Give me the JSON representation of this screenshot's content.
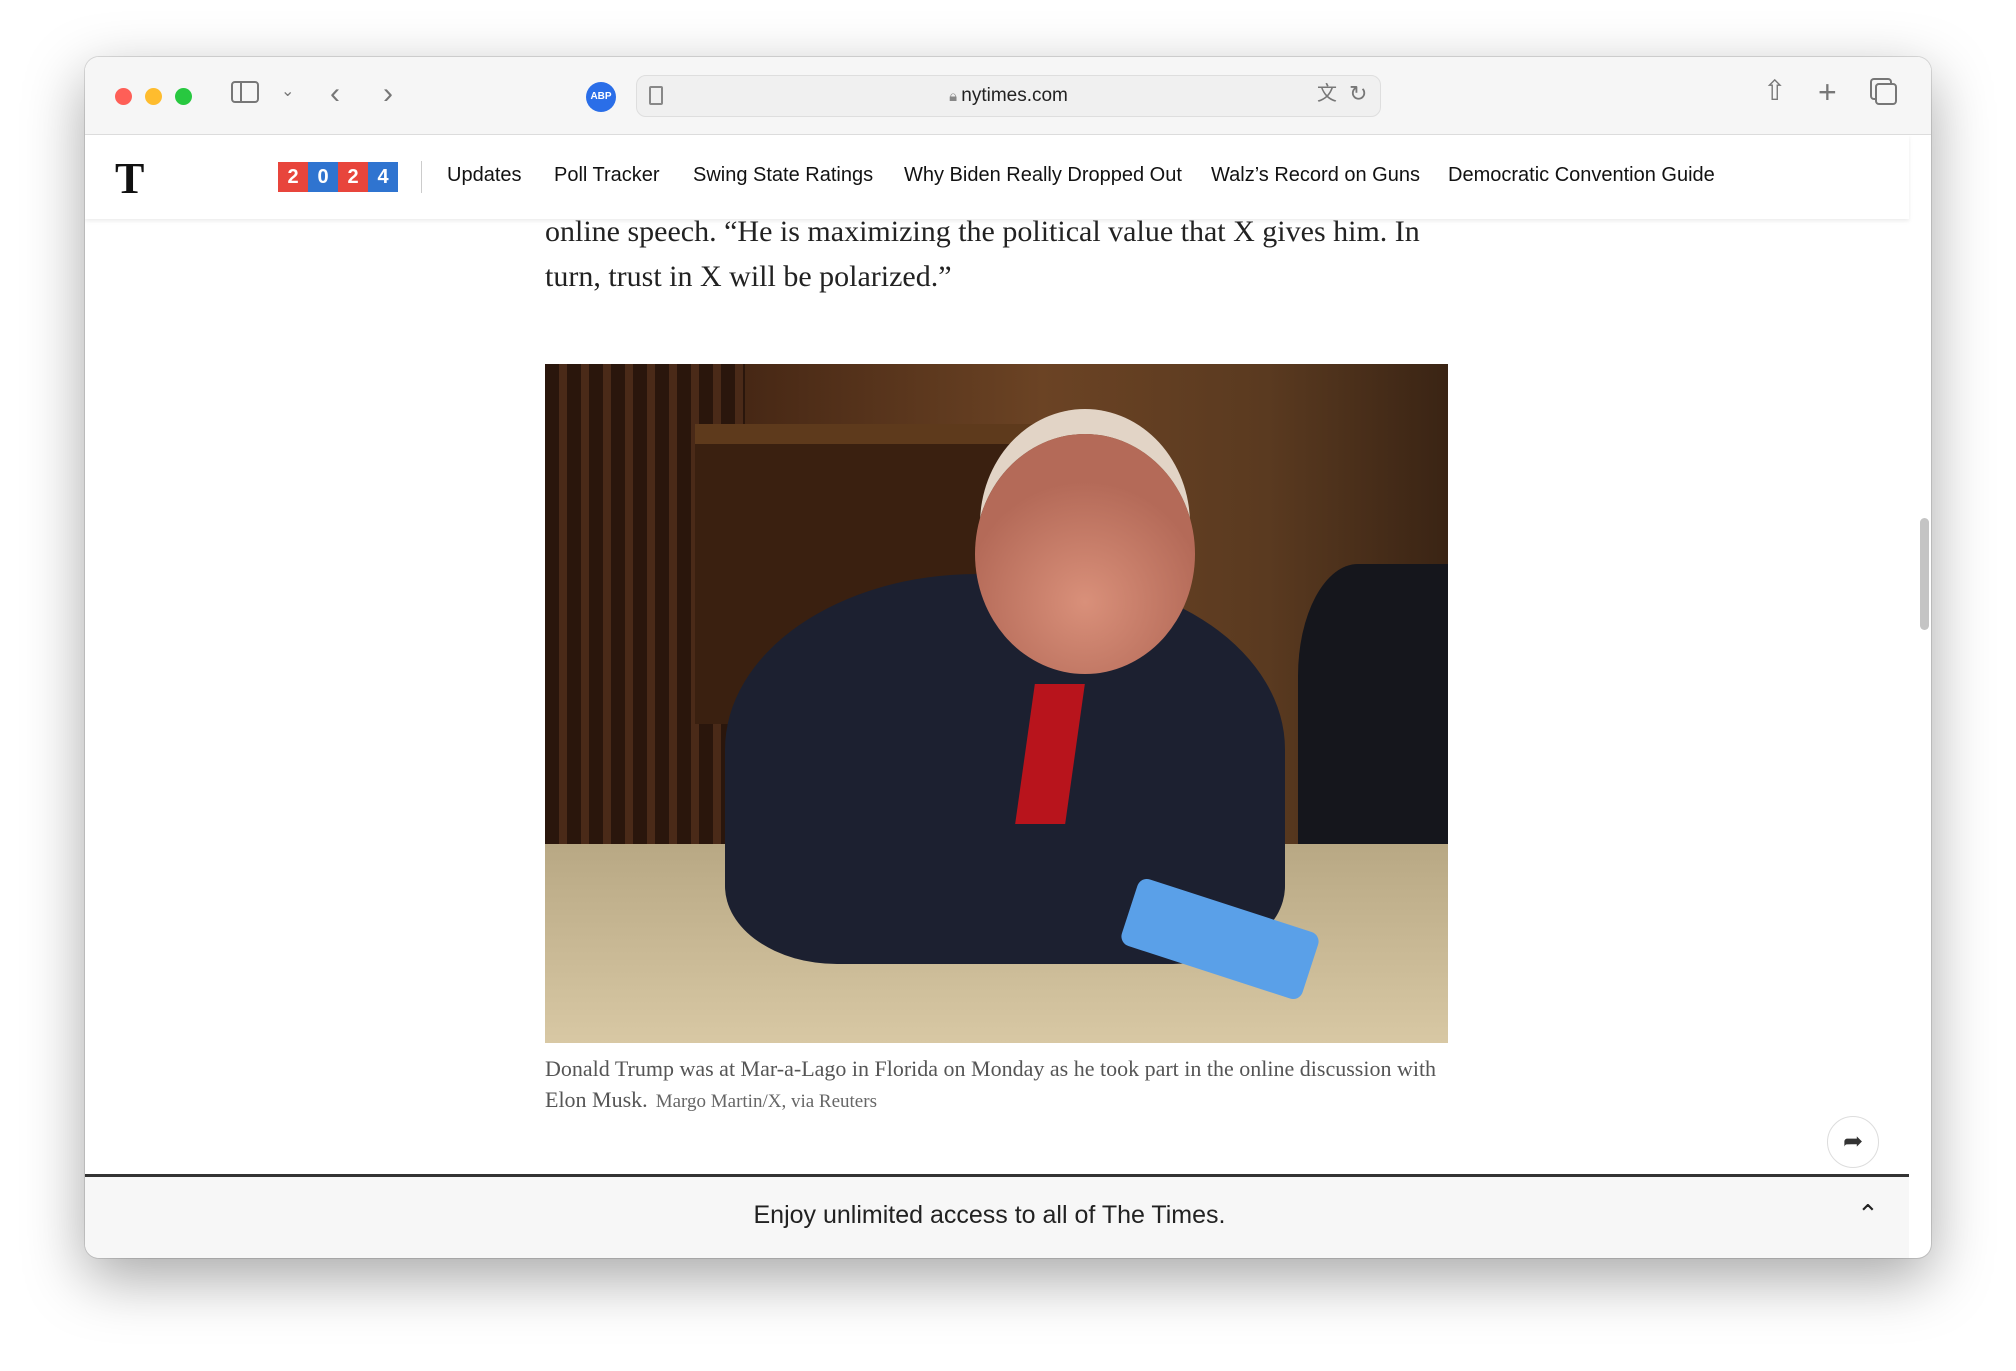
{
  "browser": {
    "url": "nytimes.com",
    "extension_badge": "ABP",
    "icons": [
      "sidebar-icon",
      "chevron-down-icon",
      "back-icon",
      "forward-icon",
      "reader-icon",
      "lock-icon",
      "translate-icon",
      "reload-icon",
      "share-icon",
      "new-tab-icon",
      "tabs-overview-icon"
    ]
  },
  "nav": {
    "logo": "T",
    "year_digits": [
      "2",
      "0",
      "2",
      "4"
    ],
    "year_colors": [
      "#e8453c",
      "#2f74d0",
      "#e8453c",
      "#2f74d0"
    ],
    "items": [
      "Updates",
      "Poll Tracker",
      "Swing State Ratings",
      "Why Biden Really Dropped Out",
      "Walz’s Record on Guns",
      "Democratic Convention Guide"
    ]
  },
  "article": {
    "body_text": "online speech. “He is maximizing the political value that X gives him. In turn, trust in X will be polarized.”",
    "caption": "Donald Trump was at Mar-a-Lago in Florida on Monday as he took part in the online discussion with Elon Musk.",
    "credit": "Margo Martin/X, via Reuters"
  },
  "banner": {
    "text": "Enjoy unlimited access to all of The Times."
  }
}
